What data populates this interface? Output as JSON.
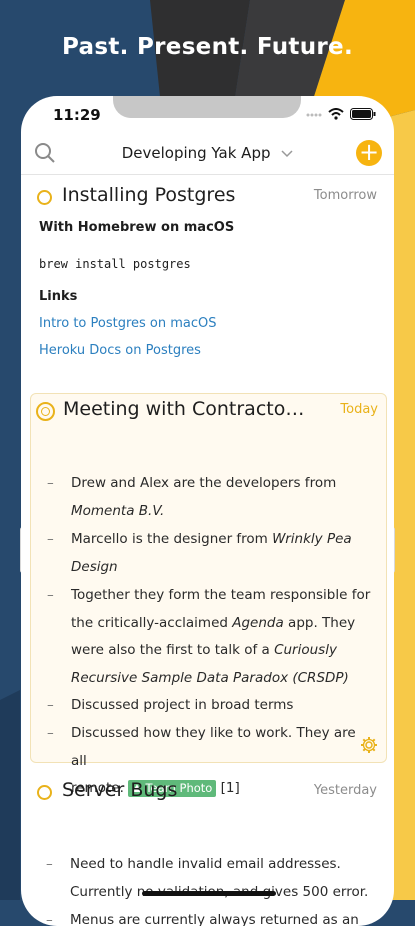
{
  "headline": "Past. Present. Future.",
  "status": {
    "time": "11:29"
  },
  "nav": {
    "title": "Developing Yak App",
    "add_label": "+"
  },
  "colors": {
    "accent": "#f7b410",
    "link": "#2b7fbf",
    "tag": "#5fb97a",
    "bg_blue": "#27496d"
  },
  "cards": [
    {
      "title": "Installing Postgres",
      "date": "Tomorrow",
      "heading1": "With Homebrew on macOS",
      "code": "brew install postgres",
      "heading2": "Links",
      "links": [
        "Intro to Postgres on macOS",
        "Heroku Docs on Postgres"
      ]
    },
    {
      "title": "Meeting with Contracto…",
      "date": "Today",
      "b1a": "Drew and Alex are the developers from",
      "b1b": "Momenta B.V.",
      "b2a": "Marcello is the designer from ",
      "b2b": "Wrinkly Pea",
      "b2c": "Design",
      "b3a": "Together they form the team responsible for",
      "b3b": "the critically-acclaimed ",
      "b3c": "Agenda",
      "b3d": " app. They",
      "b3e": "were also the first to talk of a ",
      "b3f": "Curiously",
      "b3g": "Recursive Sample Data Paradox (CRSDP)",
      "b4": "Discussed project in broad terms",
      "b5a": "Discussed how they like to work. They are all",
      "b5b": "remote. ",
      "tag": "Team Photo",
      "ref": " [1]"
    },
    {
      "title": "Server Bugs",
      "date": "Yesterday",
      "b1a": "Need to handle invalid email addresses.",
      "b1b": "Currently no validation, and gives 500 error.",
      "b2a": "Menus are currently always returned as an"
    }
  ]
}
